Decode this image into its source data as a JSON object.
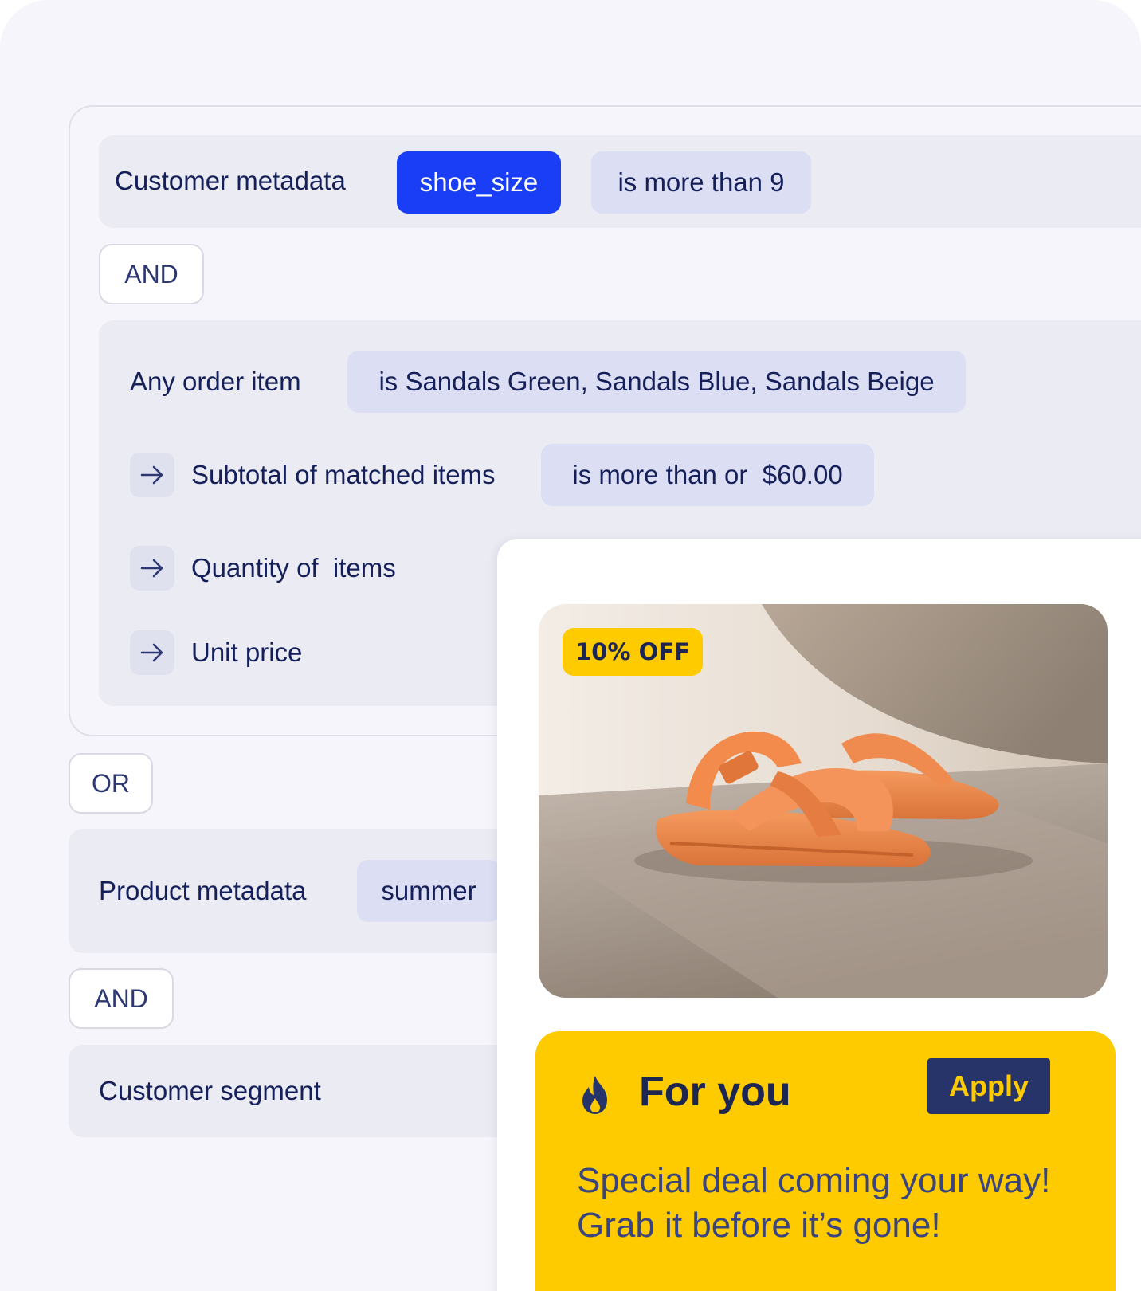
{
  "rules": {
    "customer_metadata": {
      "label": "Customer metadata",
      "field": "shoe_size",
      "condition": "is more than 9"
    },
    "and_1": "AND",
    "order_item": {
      "label": "Any order item",
      "condition": "is Sandals Green, Sandals Blue, Sandals Beige"
    },
    "subtotal": {
      "label": "Subtotal of matched items",
      "condition": "is more than or  $60.00"
    },
    "quantity": {
      "label": "Quantity of  items"
    },
    "unit_price": {
      "label": "Unit price"
    },
    "or": "OR",
    "product_metadata": {
      "label": "Product metadata",
      "value": "summer"
    },
    "and_2": "AND",
    "customer_segment": {
      "label": "Customer segment"
    }
  },
  "promo_card": {
    "badge": "10% OFF",
    "title": "For you",
    "apply_label": "Apply",
    "message_line1": "Special deal coming your way!",
    "message_line2": "Grab it before it’s gone!",
    "image_subject": "orange sandals",
    "colors": {
      "accent_yellow": "#fdcb00",
      "navy": "#26346a",
      "brand_blue": "#1a3ef5"
    }
  }
}
